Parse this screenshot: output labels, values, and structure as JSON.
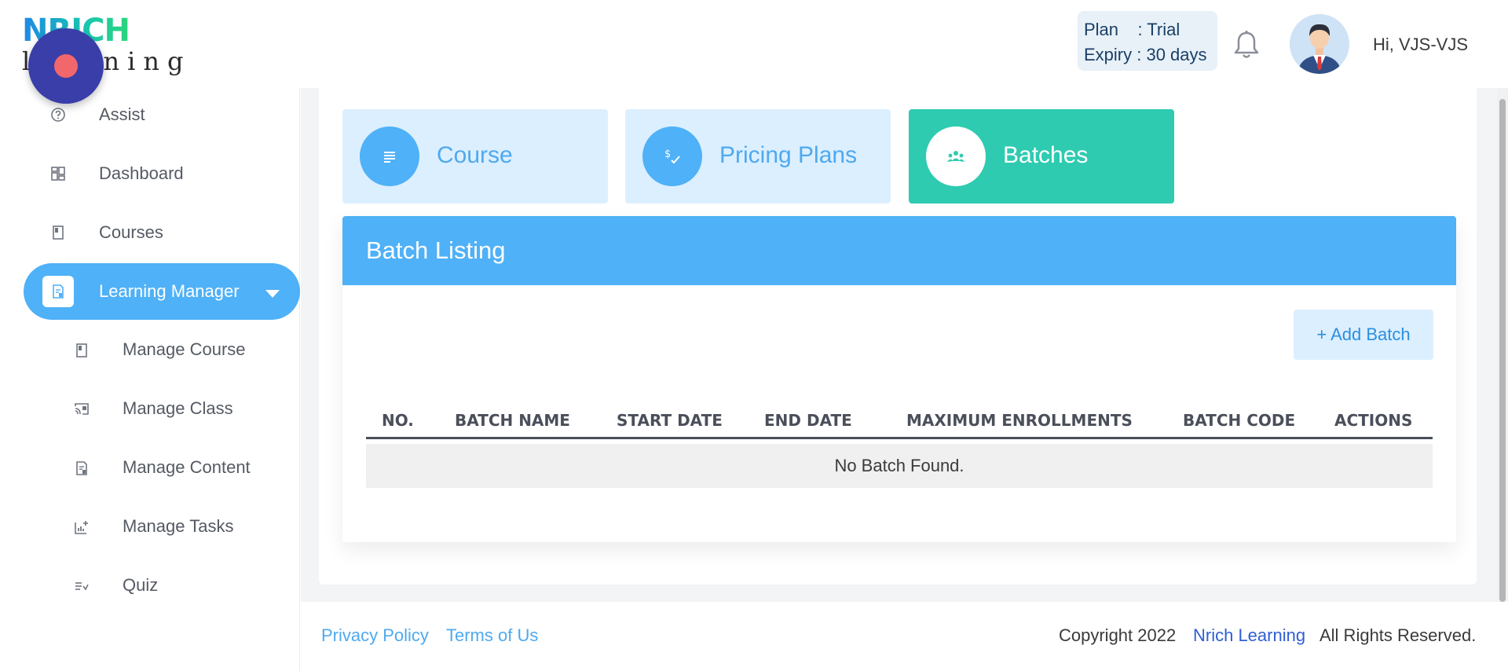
{
  "brand": {
    "logo_top": "NRICH",
    "logo_bottom": "learning"
  },
  "header": {
    "plan_line": "Plan    : Trial",
    "expiry_line": "Expiry : 30 days",
    "greeting": "Hi, VJS-VJS"
  },
  "sidebar": {
    "items": [
      {
        "label": "Assist",
        "icon": "help-icon"
      },
      {
        "label": "Dashboard",
        "icon": "dashboard-icon"
      },
      {
        "label": "Courses",
        "icon": "book-icon"
      },
      {
        "label": "Learning Manager",
        "icon": "document-icon",
        "active": true
      }
    ],
    "sub_items": [
      {
        "label": "Manage Course",
        "icon": "book-icon"
      },
      {
        "label": "Manage Class",
        "icon": "cast-icon"
      },
      {
        "label": "Manage Content",
        "icon": "document-icon"
      },
      {
        "label": "Manage Tasks",
        "icon": "chart-add-icon"
      },
      {
        "label": "Quiz",
        "icon": "list-check-icon"
      }
    ]
  },
  "tiles": [
    {
      "label": "Course",
      "icon": "lines-icon"
    },
    {
      "label": "Pricing Plans",
      "icon": "dollar-check-icon"
    },
    {
      "label": "Batches",
      "icon": "group-icon",
      "active": true
    }
  ],
  "listing": {
    "title": "Batch Listing",
    "add_button": "+ Add Batch",
    "columns": [
      "NO.",
      "BATCH NAME",
      "START DATE",
      "END DATE",
      "MAXIMUM ENROLLMENTS",
      "BATCH CODE",
      "ACTIONS"
    ],
    "empty_message": "No Batch Found."
  },
  "footer": {
    "privacy": "Privacy Policy",
    "terms": "Terms of Us",
    "copyright": "Copyright 2022",
    "brand_link": "Nrich Learning",
    "rights": "All Rights Reserved."
  },
  "colors": {
    "accent_blue": "#4fb1f7",
    "accent_green": "#2ecbb0",
    "tile_light": "#dcefff",
    "fab": "#3a3ea8",
    "fab_dot": "#f2676b"
  }
}
